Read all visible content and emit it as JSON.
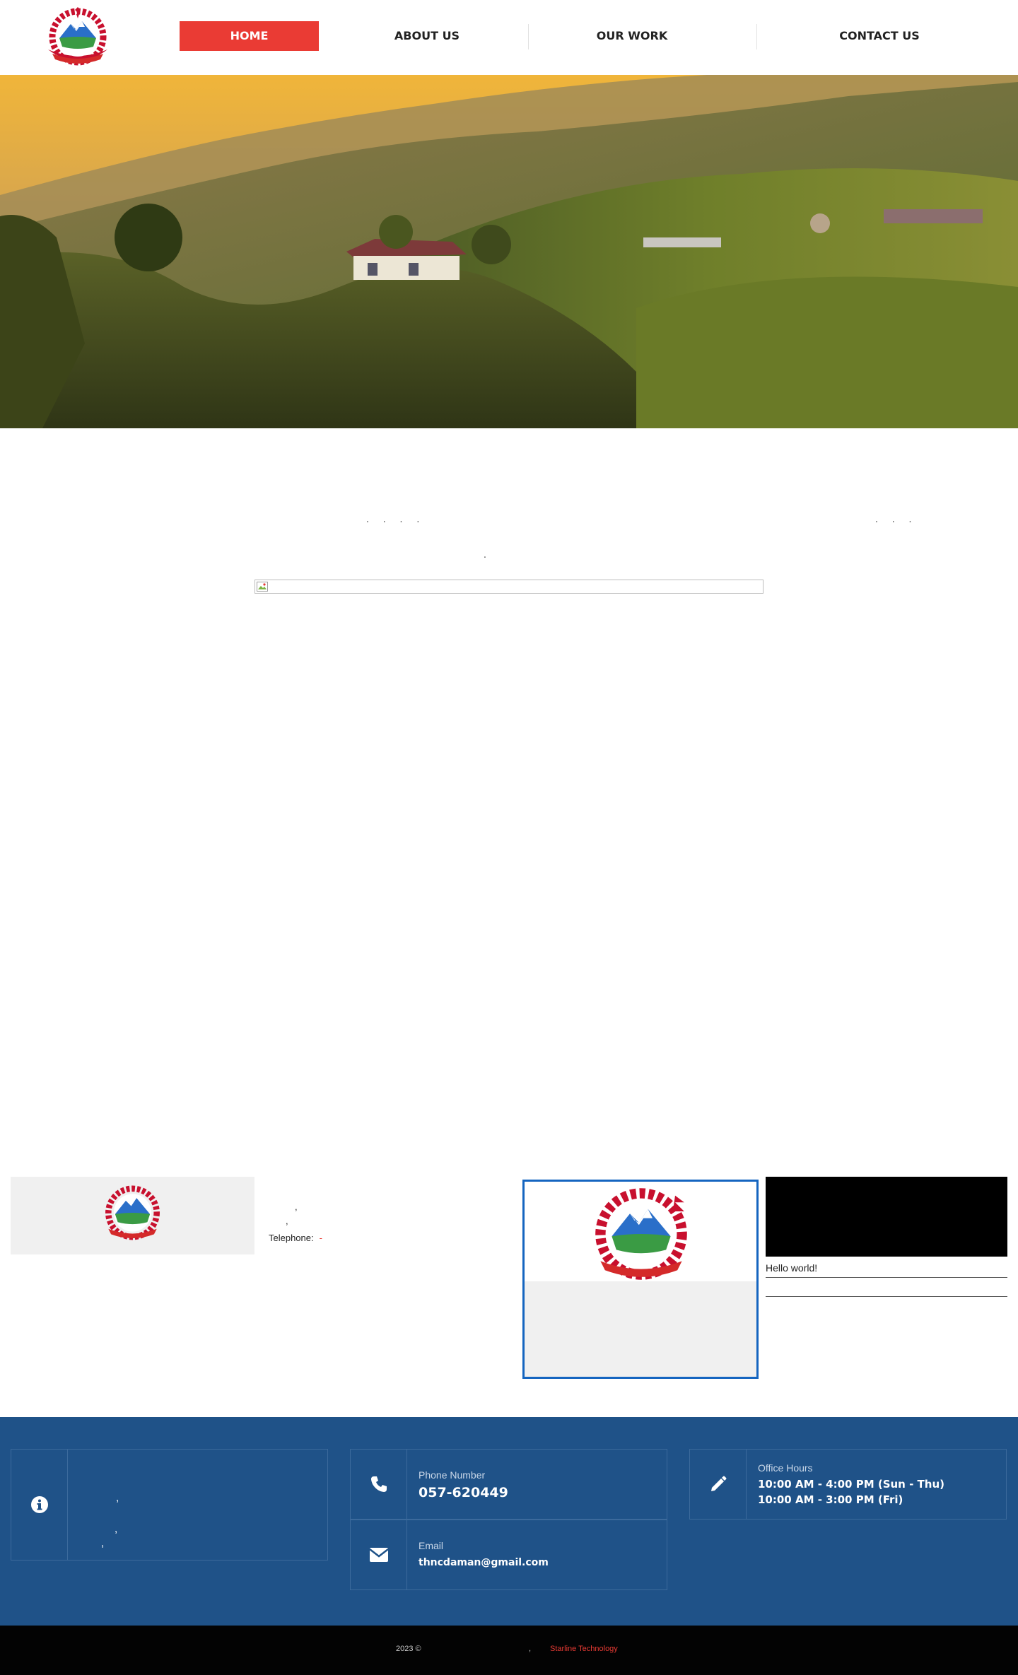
{
  "nav": {
    "items": [
      {
        "label": "HOME",
        "active": true
      },
      {
        "label": "ABOUT US",
        "active": false
      },
      {
        "label": "OUR WORK",
        "active": false
      },
      {
        "label": "CONTACT US",
        "active": false
      }
    ]
  },
  "intro": {
    "dots_left": ". . .   .",
    "dots_right": ". . .",
    "dot_center": "."
  },
  "contact_widget": {
    "comma1": ",",
    "comma2": ",",
    "telephone_label": "Telephone:",
    "telephone_value": "-"
  },
  "news": {
    "items": [
      "Hello world!",
      ""
    ]
  },
  "footer": {
    "address_commas": [
      ",",
      ",",
      ","
    ],
    "phone": {
      "label": "Phone Number",
      "value": "057-620449"
    },
    "email": {
      "label": "Email",
      "value": "thncdaman@gmail.com"
    },
    "hours": {
      "label": "Office Hours",
      "line1": "10:00 AM - 4:00 PM (Sun - Thu)",
      "line2": "10:00 AM - 3:00 PM (Fri)"
    }
  },
  "bottom_bar": {
    "copyright": "2023 ©",
    "separator": ",",
    "credit": "Starline Technology"
  },
  "colors": {
    "accent": "#ea3b34",
    "footer_bg": "#1f5288",
    "card_border": "#1565c0",
    "bottom_bg": "#030303"
  },
  "icons": [
    "nepal-emblem-logo",
    "info-icon",
    "phone-icon",
    "envelope-icon",
    "pencil-icon",
    "broken-image-icon"
  ]
}
